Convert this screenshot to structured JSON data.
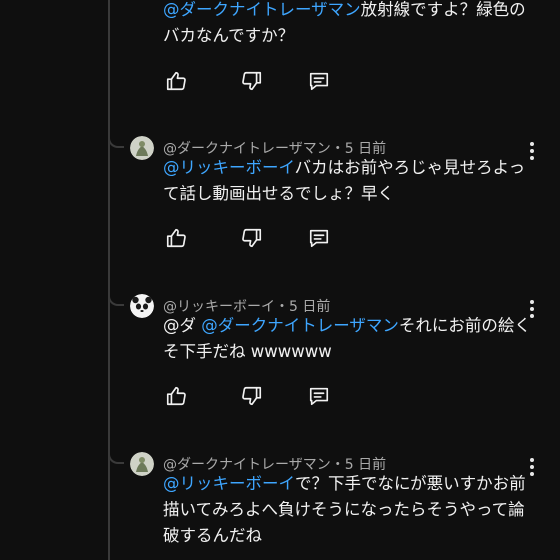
{
  "comments": [
    {
      "author": "",
      "meta": "",
      "mention": "@ダークナイトレーザマン",
      "prefix": "",
      "text": "放射線ですよ？緑色のバカなんですか？"
    },
    {
      "author": "@ダークナイトレーザマン",
      "meta": "@ダークナイトレーザマン・5 日前",
      "mention": "@リッキーボーイ",
      "prefix": "",
      "text": "バカはお前やろじゃ見せろよって話し動画出せるでしょ？早く"
    },
    {
      "author": "@リッキーボーイ",
      "meta": "@リッキーボーイ・5 日前",
      "prefix": "@ダ ",
      "mention": "@ダークナイトレーザマン",
      "text": "それにお前の絵くそ下手だね wwwwww"
    },
    {
      "author": "@ダークナイトレーザマン",
      "meta": "@ダークナイトレーザマン・5 日前",
      "mention": "@リッキーボーイ",
      "prefix": "",
      "text": "で？下手でなにが悪いすかお前描いてみろよへ負けそうになったらそうやって論破するんだね"
    }
  ],
  "icons": {
    "like": "thumbs-up-icon",
    "dislike": "thumbs-down-icon",
    "reply": "reply-comment-icon",
    "more": "more-vertical-icon"
  },
  "colors": {
    "background": "#0f0f0f",
    "mention": "#3ea6ff",
    "meta": "#aaaaaa"
  }
}
